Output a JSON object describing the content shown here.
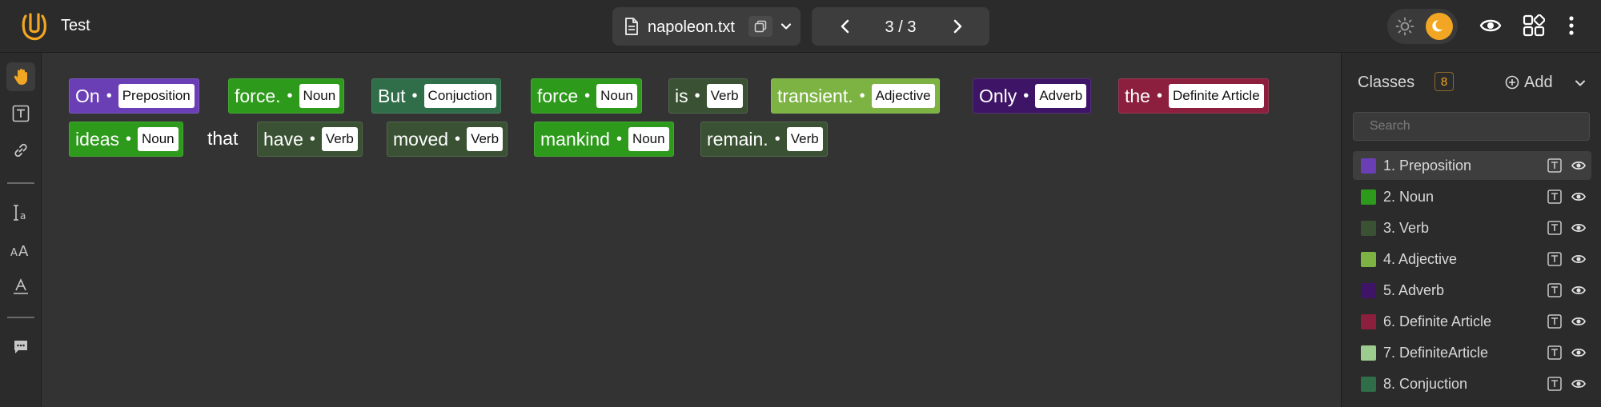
{
  "app": {
    "title": "Test"
  },
  "file": {
    "name": "napoleon.txt"
  },
  "pager": {
    "label": "3 / 3"
  },
  "tokens": [
    {
      "word": "On",
      "label": "Preposition",
      "color": "#6a3fb5"
    },
    {
      "word": "force.",
      "label": "Noun",
      "color": "#2e9a1c"
    },
    {
      "word": "But",
      "label": "Conjuction",
      "color": "#2f6e48"
    },
    {
      "word": "force",
      "label": "Noun",
      "color": "#2e9a1c"
    },
    {
      "word": "is",
      "label": "Verb",
      "color": "#3a5233"
    },
    {
      "word": "transient.",
      "label": "Adjective",
      "color": "#7cb342"
    },
    {
      "word": "Only",
      "label": "Adverb",
      "color": "#3e1466"
    },
    {
      "word": "the",
      "label": "Definite Article",
      "color": "#8c1f3d"
    },
    {
      "word": "ideas",
      "label": "Noun",
      "color": "#2e9a1c"
    },
    {
      "word": "that",
      "label": "",
      "color": ""
    },
    {
      "word": "have",
      "label": "Verb",
      "color": "#3a5233"
    },
    {
      "word": "moved",
      "label": "Verb",
      "color": "#3a5233"
    },
    {
      "word": "mankind",
      "label": "Noun",
      "color": "#2e9a1c"
    },
    {
      "word": "remain.",
      "label": "Verb",
      "color": "#3a5233"
    }
  ],
  "panel": {
    "title": "Classes",
    "count": "8",
    "add_label": "Add",
    "search_placeholder": "Search",
    "classes": [
      {
        "label": "1. Preposition",
        "color": "#6a3fb5"
      },
      {
        "label": "2. Noun",
        "color": "#2e9a1c"
      },
      {
        "label": "3. Verb",
        "color": "#3a5233"
      },
      {
        "label": "4. Adjective",
        "color": "#7cb342"
      },
      {
        "label": "5. Adverb",
        "color": "#3e1466"
      },
      {
        "label": "6. Definite Article",
        "color": "#8c1f3d"
      },
      {
        "label": "7. DefiniteArticle",
        "color": "#9ccc8e"
      },
      {
        "label": "8. Conjuction",
        "color": "#2f6e48"
      }
    ]
  },
  "icons": {
    "tools": [
      "hand-icon",
      "text-box-icon",
      "link-icon",
      "text-cursor-icon",
      "font-size-icon",
      "text-format-icon",
      "comment-icon"
    ],
    "top": [
      "file-icon",
      "copy-icon",
      "chevron-down-icon",
      "chevron-left-icon",
      "chevron-right-icon",
      "sun-icon",
      "moon-icon",
      "eye-icon",
      "layout-grid-icon",
      "more-vertical-icon"
    ]
  },
  "colors": {
    "accent": "#f2a623"
  }
}
